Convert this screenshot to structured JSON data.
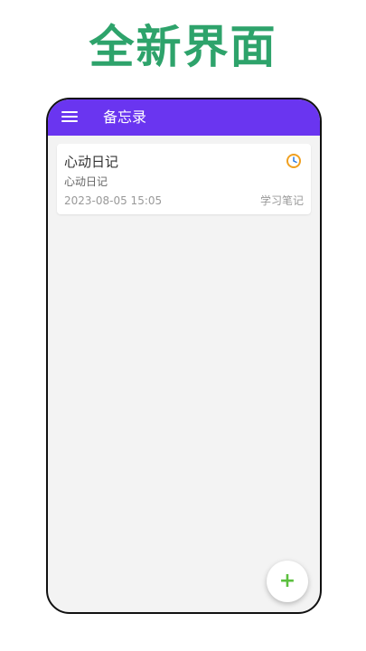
{
  "promo": {
    "title": "全新界面"
  },
  "appbar": {
    "title": "备忘录",
    "menu_icon": "hamburger-menu-icon"
  },
  "notes": [
    {
      "title": "心动日记",
      "subtitle": "心动日记",
      "time": "2023-08-05 15:05",
      "category": "学习笔记",
      "icon": "clock-icon"
    }
  ],
  "fab": {
    "label": "+",
    "icon": "plus-icon"
  },
  "colors": {
    "accent": "#6a35f0",
    "promo_text": "#2ea36b",
    "fab_plus": "#5bbf3e",
    "clock": "#f0a020"
  }
}
